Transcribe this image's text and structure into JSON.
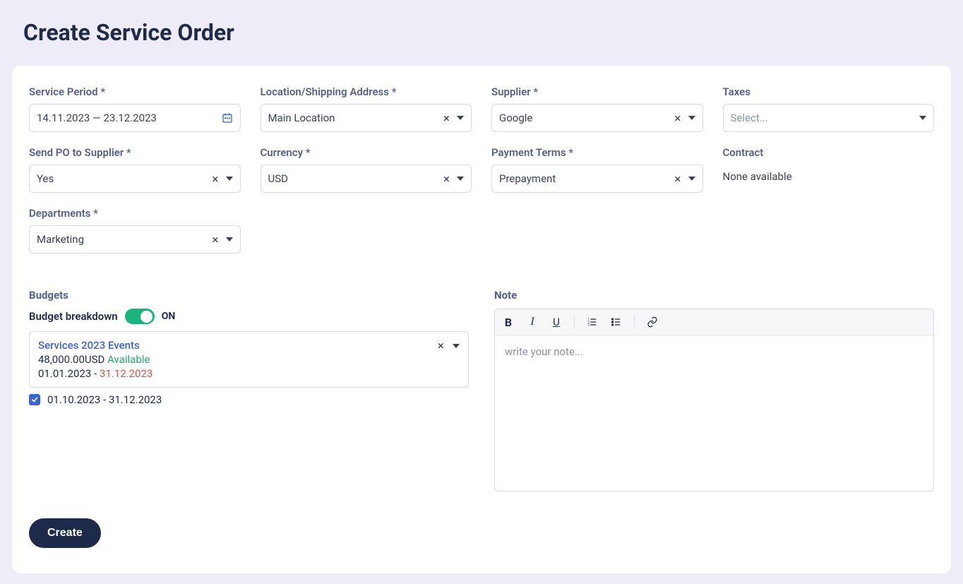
{
  "page": {
    "title": "Create Service Order"
  },
  "labels": {
    "service_period": "Service Period *",
    "location": "Location/Shipping Address *",
    "supplier": "Supplier *",
    "taxes": "Taxes",
    "send_po": "Send PO to Supplier *",
    "currency": "Currency *",
    "payment_terms": "Payment Terms *",
    "contract": "Contract",
    "departments": "Departments *",
    "budgets_header": "Budgets",
    "budget_breakdown": "Budget breakdown",
    "note_header": "Note"
  },
  "values": {
    "service_period": "14.11.2023 — 23.12.2023",
    "location": "Main Location",
    "supplier": "Google",
    "taxes_placeholder": "Select...",
    "send_po": "Yes",
    "currency": "USD",
    "payment_terms": "Prepayment",
    "contract_none": "None available",
    "departments": "Marketing",
    "toggle_state": "ON",
    "note_placeholder": "write your note..."
  },
  "budget": {
    "name": "Services 2023 Events",
    "amount": "48,000.00USD",
    "available_label": " Available",
    "start": "01.01.2023",
    "end": "31.12.2023",
    "dash": " - "
  },
  "period_checkbox": {
    "range": "01.10.2023 - 31.12.2023"
  },
  "buttons": {
    "create": "Create"
  }
}
